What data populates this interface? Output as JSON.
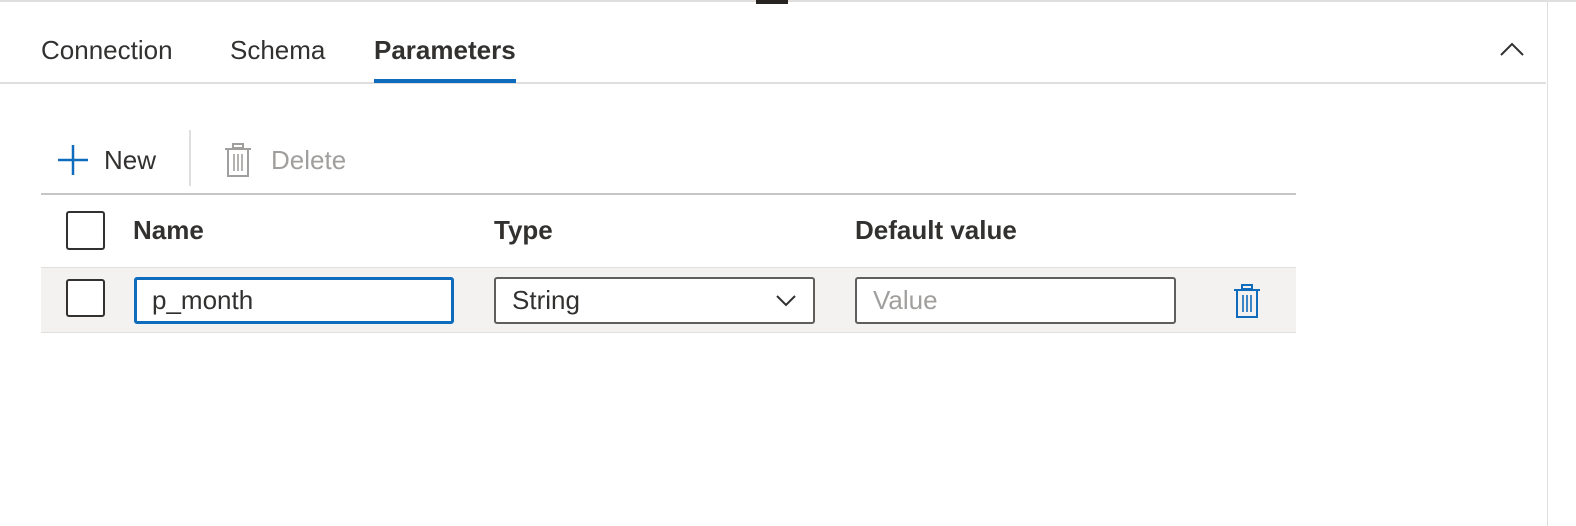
{
  "tabs": {
    "connection": "Connection",
    "schema": "Schema",
    "parameters": "Parameters",
    "active": "Parameters"
  },
  "toolbar": {
    "new_label": "New",
    "delete_label": "Delete",
    "new_icon": "plus-icon",
    "delete_icon": "trash-icon"
  },
  "table": {
    "columns": {
      "name": "Name",
      "type": "Type",
      "default_value": "Default value"
    },
    "rows": [
      {
        "name": "p_month",
        "type": "String",
        "default_value": "",
        "default_value_placeholder": "Value"
      }
    ]
  },
  "colors": {
    "accent": "#0f6cbd",
    "disabled": "#a19f9d",
    "row_background": "#f3f2f1",
    "border": "#e1dfdd"
  }
}
